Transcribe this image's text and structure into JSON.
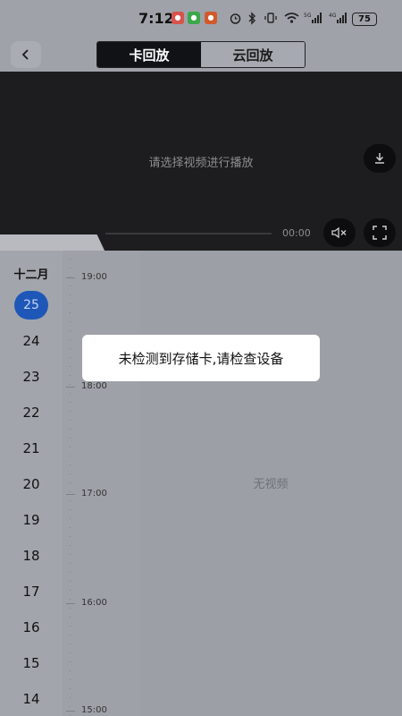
{
  "status_bar": {
    "time": "7:12",
    "battery": "75",
    "icons": [
      "alarm-icon",
      "bluetooth-icon",
      "vibrate-icon",
      "wifi-icon",
      "5g-signal-icon",
      "4g-signal-icon"
    ]
  },
  "header": {
    "tabs": [
      {
        "label": "卡回放",
        "active": true
      },
      {
        "label": "云回放",
        "active": false
      }
    ]
  },
  "video": {
    "message": "请选择视频进行播放",
    "time": "00:00"
  },
  "calendar": {
    "month": "十二月",
    "dates": [
      "25",
      "24",
      "23",
      "22",
      "21",
      "20",
      "19",
      "18",
      "17",
      "16",
      "15",
      "14"
    ],
    "selected": "25"
  },
  "timeline": {
    "labels": [
      "19:00",
      "18:00",
      "17:00",
      "16:00",
      "15:00"
    ]
  },
  "main": {
    "empty_text": "无视频"
  },
  "toast": {
    "text": "未检测到存储卡,请检查设备"
  },
  "colors": {
    "accent": "#1e57b8",
    "tab_active_bg": "#101216",
    "video_bg": "#1d1c1e"
  }
}
